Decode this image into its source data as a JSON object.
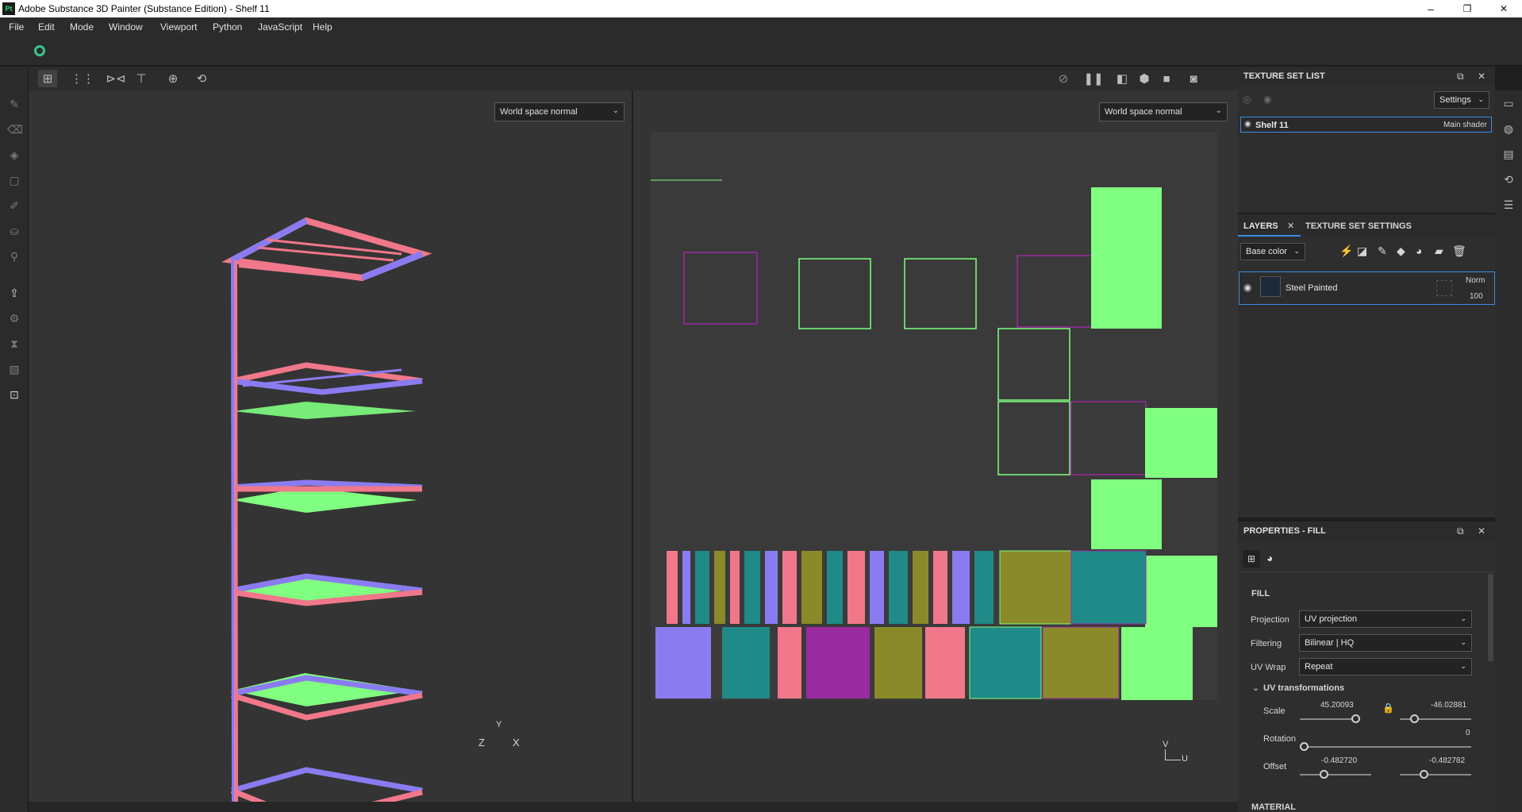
{
  "window": {
    "title": "Adobe Substance 3D Painter (Substance Edition) - Shelf 11",
    "logo": "Pt",
    "min": "–",
    "max": "❐",
    "close": "✕"
  },
  "menu": [
    "File",
    "Edit",
    "Mode",
    "Window",
    "Viewport",
    "Python",
    "JavaScript",
    "Help"
  ],
  "viewport3d": {
    "display_mode": "World space normal",
    "axis_y": "Y",
    "axis_z": "Z",
    "axis_x": "X"
  },
  "viewport2d": {
    "display_mode": "World space normal",
    "axis_v": "V",
    "axis_u": "U"
  },
  "texture_set_list": {
    "title": "TEXTURE SET LIST",
    "settings_label": "Settings",
    "item_name": "Shelf 11",
    "item_shader": "Main shader"
  },
  "layers": {
    "tab_layers": "LAYERS",
    "tab_tss": "TEXTURE SET SETTINGS",
    "channel": "Base color",
    "layer_name": "Steel Painted",
    "blend_mode": "Norm",
    "opacity": "100"
  },
  "properties": {
    "title": "PROPERTIES - FILL",
    "section": "FILL",
    "projection_label": "Projection",
    "projection_value": "UV projection",
    "filtering_label": "Filtering",
    "filtering_value": "Bilinear | HQ",
    "uvwrap_label": "UV Wrap",
    "uvwrap_value": "Repeat",
    "uvtrans_label": "UV transformations",
    "scale_label": "Scale",
    "scale_u": "45.20093",
    "scale_v": "-46.02881",
    "rotation_label": "Rotation",
    "rotation_value": "0",
    "offset_label": "Offset",
    "offset_u": "-0.482720",
    "offset_v": "-0.482782",
    "material_label": "MATERIAL"
  },
  "colors": {
    "normal_pink": "#f0788a",
    "normal_blue": "#8a7cf0",
    "normal_green": "#80ff80",
    "accent": "#3a8ee6"
  }
}
